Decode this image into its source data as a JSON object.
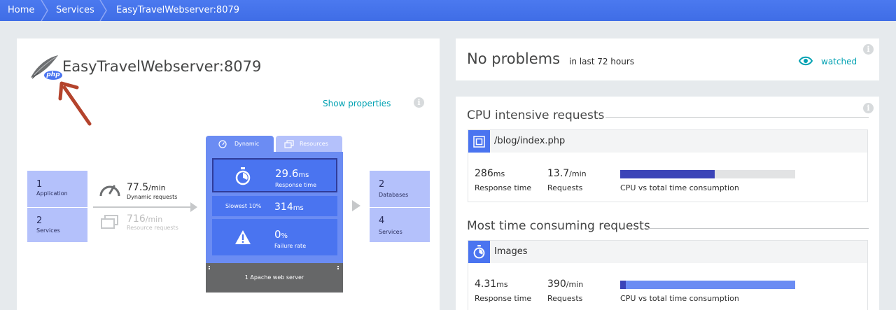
{
  "breadcrumb": [
    "Home",
    "Services",
    "EasyTravelWebserver:8079"
  ],
  "service": {
    "name": "EasyTravelWebserver:8079",
    "show_properties": "Show properties",
    "php_badge": "php"
  },
  "flow": {
    "left_boxes": [
      {
        "count": "1",
        "label": "Application"
      },
      {
        "count": "2",
        "label": "Services"
      }
    ],
    "dynamic": {
      "value": "77.5",
      "unit": "/min",
      "label": "Dynamic requests"
    },
    "resource": {
      "value": "716",
      "unit": "/min",
      "label": "Resource requests"
    },
    "tabs": [
      "Dynamic",
      "Resources"
    ],
    "response_time": {
      "value": "29.6",
      "unit": "ms",
      "label": "Response time"
    },
    "slowest": {
      "label": "Slowest 10%",
      "value": "314",
      "unit": "ms"
    },
    "failure_rate": {
      "value": "0",
      "unit": "%",
      "label": "Failure rate"
    },
    "server_label": "1 Apache web server",
    "right_boxes": [
      {
        "count": "2",
        "label": "Databases"
      },
      {
        "count": "4",
        "label": "Services"
      }
    ]
  },
  "problems": {
    "title": "No problems",
    "period": "in last 72 hours",
    "watched": "watched"
  },
  "cpu_section": {
    "title": "CPU intensive requests",
    "request": {
      "name": "/blog/index.php",
      "response_time": "286",
      "response_unit": "ms",
      "response_label": "Response time",
      "requests": "13.7",
      "requests_unit": "/min",
      "requests_label": "Requests",
      "bar_label": "CPU vs total time consumption",
      "cpu_fraction": 0.54,
      "total_fraction": 0.54
    }
  },
  "time_section": {
    "title": "Most time consuming requests",
    "request": {
      "name": "Images",
      "response_time": "4.31",
      "response_unit": "ms",
      "response_label": "Response time",
      "requests": "390",
      "requests_unit": "/min",
      "requests_label": "Requests",
      "bar_label": "CPU vs total time consumption",
      "cpu_fraction": 0.03,
      "total_fraction": 1.0
    }
  },
  "colors": {
    "accent": "#4a74f0",
    "breadcrumb": "#4674ec",
    "teal": "#00a1b2",
    "box": "#b4c1fb",
    "cpu_bar": "#3b44b8",
    "total_bar": "#6b8cf3",
    "arrow": "#b4432c"
  }
}
